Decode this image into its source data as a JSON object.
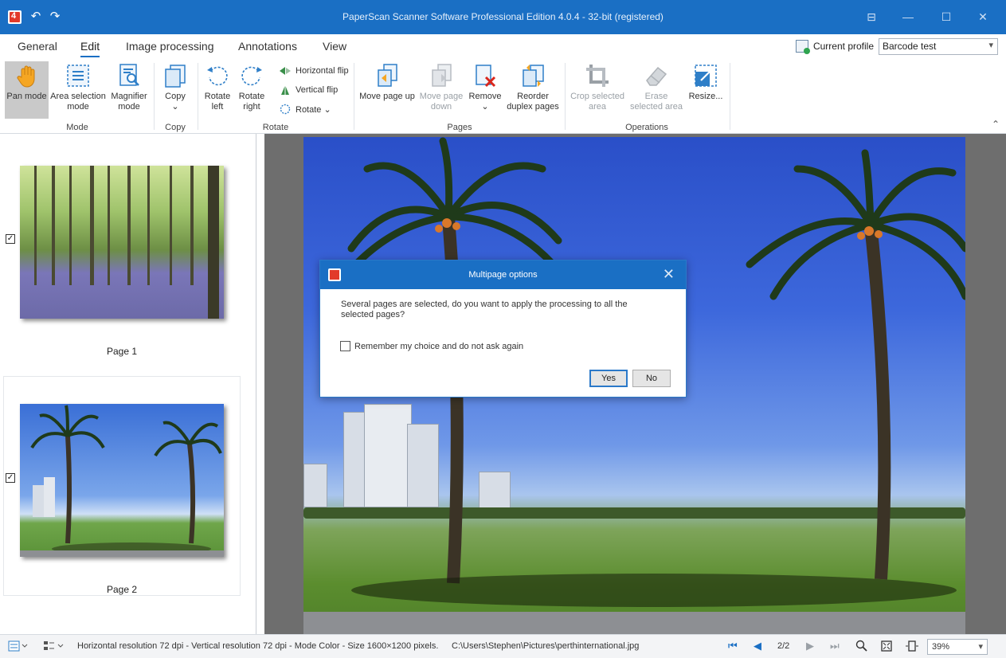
{
  "window": {
    "title": "PaperScan Scanner Software Professional Edition 4.0.4 - 32-bit (registered)",
    "controls": [
      "⊟",
      "—",
      "☐",
      "✕"
    ]
  },
  "quick_access": {
    "undo": "↶",
    "redo": "↷"
  },
  "tabs": [
    "General",
    "Edit",
    "Image processing",
    "Annotations",
    "View"
  ],
  "active_tab": "Edit",
  "profile": {
    "label": "Current profile",
    "value": "Barcode test"
  },
  "ribbon": {
    "mode": {
      "label": "Mode",
      "pan": "Pan mode",
      "area_1": "Area selection",
      "area_2": "mode",
      "magnifier_1": "Magnifier",
      "magnifier_2": "mode"
    },
    "copy": {
      "label": "Copy",
      "button": "Copy",
      "arrow": "⌄"
    },
    "rotate": {
      "label": "Rotate",
      "left_1": "Rotate",
      "left_2": "left",
      "right_1": "Rotate",
      "right_2": "right",
      "hflip": "Horizontal flip",
      "vflip": "Vertical flip",
      "rotate": "Rotate ⌄"
    },
    "pages": {
      "label": "Pages",
      "move_up": "Move page up",
      "move_down_1": "Move page",
      "move_down_2": "down",
      "remove": "Remove",
      "remove_arrow": "⌄",
      "reorder_1": "Reorder",
      "reorder_2": "duplex pages"
    },
    "operations": {
      "label": "Operations",
      "crop_1": "Crop selected",
      "crop_2": "area",
      "erase_1": "Erase",
      "erase_2": "selected area",
      "resize": "Resize..."
    },
    "collapse": "⌃"
  },
  "thumbnails": [
    {
      "label": "Page 1",
      "checked": "✓"
    },
    {
      "label": "Page 2",
      "checked": "✓"
    }
  ],
  "dialog": {
    "title": "Multipage options",
    "close": "✕",
    "message": "Several pages are selected, do you want to apply the processing to all the selected pages?",
    "checkbox_label": "Remember my choice and do not ask again",
    "yes": "Yes",
    "no": "No"
  },
  "status": {
    "info": "Horizontal resolution  72 dpi - Vertical resolution  72 dpi - Mode Color - Size 1600×1200 pixels.",
    "path": "C:\\Users\\Stephen\\Pictures\\perthinternational.jpg",
    "page": "2/2",
    "zoom": "39%"
  },
  "colors": {
    "accent": "#1a6fc4",
    "remove_red": "#d9261c",
    "viewer_bg": "#6e6e6e"
  }
}
